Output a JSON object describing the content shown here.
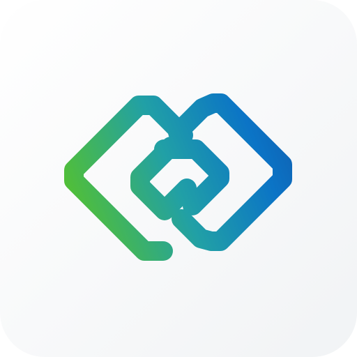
{
  "app_icon": {
    "name": "interlocked-diamonds-logo",
    "colors": {
      "background_top": "#ffffff",
      "background_bottom": "#f1f3f5",
      "gradient_green": "#56c22c",
      "gradient_teal": "#21a0a6",
      "gradient_blue": "#0b74c6",
      "gradient_deep_blue": "#1060b1"
    }
  }
}
